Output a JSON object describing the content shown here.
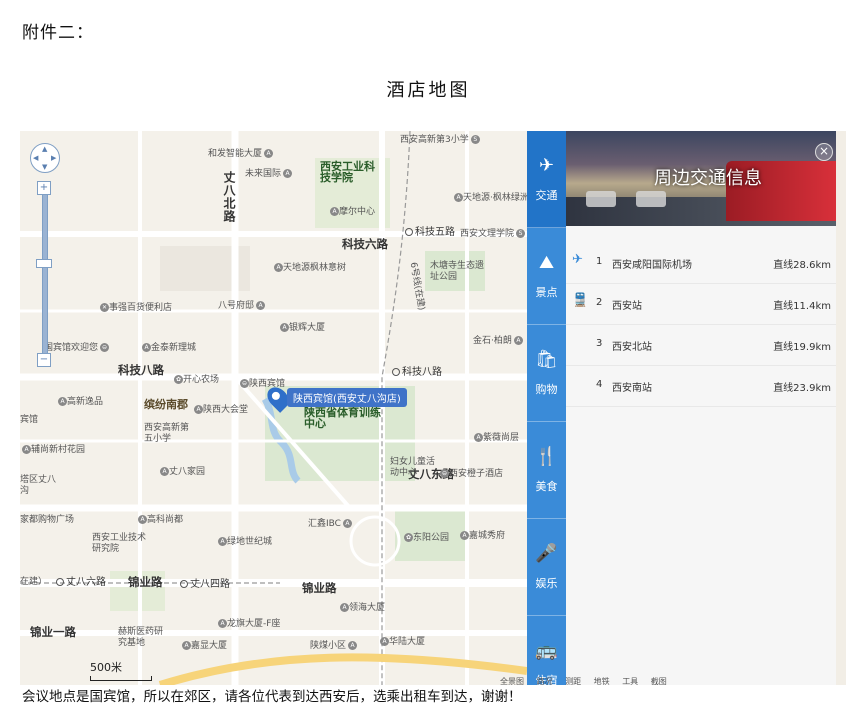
{
  "heading": "附件二：",
  "title": "酒店地图",
  "map": {
    "zoom_plus": "+",
    "zoom_minus": "−",
    "scale_label": "500米",
    "marker_label": "陕西宾馆(西安丈八沟店)",
    "roads": {
      "keji6": "科技六路",
      "keji8": "科技八路",
      "keji5": "科技五路",
      "zhangba_north": "丈八北路",
      "zhangba_east": "丈八东路",
      "jinye": "锦业路",
      "jinye1": "锦业一路",
      "zhangba6": "丈八六路",
      "zhangba4": "丈八四路",
      "metro6": "6号线(在建)",
      "zaijian": "在建）"
    },
    "pois": {
      "hefa": "和发智能大厦",
      "weilai": "未来国际",
      "xigong": "西安工业科技学院",
      "moer": "摩尔中心",
      "xiangao3": "西安高新第3小学",
      "tiandi_feng": "天地源·枫林绿洲",
      "xa_wenli": "西安文理学院",
      "tiandi_yi": "天地源枫林意树",
      "mutang": "木塘寺生态遗址公园",
      "shizhi": "事强百货便利店",
      "bahao": "八号府邸",
      "yinhui": "银辉大厦",
      "jinshi": "金石·柏朗",
      "binguan_welcome": "国宾馆欢迎您",
      "jintai": "金泰新理城",
      "kaixin": "开心农场",
      "shaanxi_bg": "陕西宾馆",
      "gaoxin_yipin": "高新逸品",
      "binfen": "缤纷南郡",
      "shaanxi_dht": "陕西大会堂",
      "shaanxi_sport": "陕西省体育训练中心",
      "binguan": "宾馆",
      "gaoxin5": "西安高新第五小学",
      "jinghui": "辅尚新村花园",
      "wenba": "丈八家园",
      "ziwei": "紫薇尚层",
      "fuyou": "妇女儿童活动中心",
      "xi_chengzi": "西安橙子酒店",
      "zb_qu": "塔区丈八沟",
      "jiadu": "家都购物广场",
      "gaoke": "高科尚都",
      "huiding": "汇鑫IBC",
      "dongyang": "东阳公园",
      "jucheng": "嘉城秀府",
      "xigong_tech": "西安工业技术研究院",
      "lvdi": "绿地世纪城",
      "lingxian": "领海大厦",
      "longqi": "龙旗大厦-F座",
      "hanxin": "赫斯医药研究基地",
      "jiaxian": "嘉显大厦",
      "shaanxi_xq": "陕煤小区",
      "huaiu": "华陆大厦"
    }
  },
  "tabs": [
    {
      "icon": "airplane-icon",
      "glyph": "✈",
      "label": "交通"
    },
    {
      "icon": "mountain-icon",
      "glyph": "⛰",
      "label": "景点"
    },
    {
      "icon": "shopping-bag-icon",
      "glyph": "🛍",
      "label": "购物"
    },
    {
      "icon": "fork-knife-icon",
      "glyph": "🍴",
      "label": "美食"
    },
    {
      "icon": "microphone-icon",
      "glyph": "🎤",
      "label": "娱乐"
    },
    {
      "icon": "bus-icon",
      "glyph": "🚌",
      "label": "住宿"
    }
  ],
  "panel": {
    "banner_text": "周边交通信息",
    "close": "×",
    "rows": [
      {
        "category_icon": "airplane-icon",
        "glyph": "✈",
        "num": "1",
        "name": "西安咸阳国际机场",
        "dist": "直线28.6km"
      },
      {
        "category_icon": "train-icon",
        "glyph": "🚆",
        "num": "2",
        "name": "西安站",
        "dist": "直线11.4km"
      },
      {
        "category_icon": "",
        "glyph": "",
        "num": "3",
        "name": "西安北站",
        "dist": "直线19.9km"
      },
      {
        "category_icon": "",
        "glyph": "",
        "num": "4",
        "name": "西安南站",
        "dist": "直线23.9km"
      }
    ]
  },
  "statusbar": [
    "全景图",
    "路况",
    "测距",
    "地铁",
    "工具",
    "截图"
  ],
  "footer": "会议地点是国宾馆，所以在郊区，请各位代表到达西安后，选乘出租车到达，谢谢！"
}
